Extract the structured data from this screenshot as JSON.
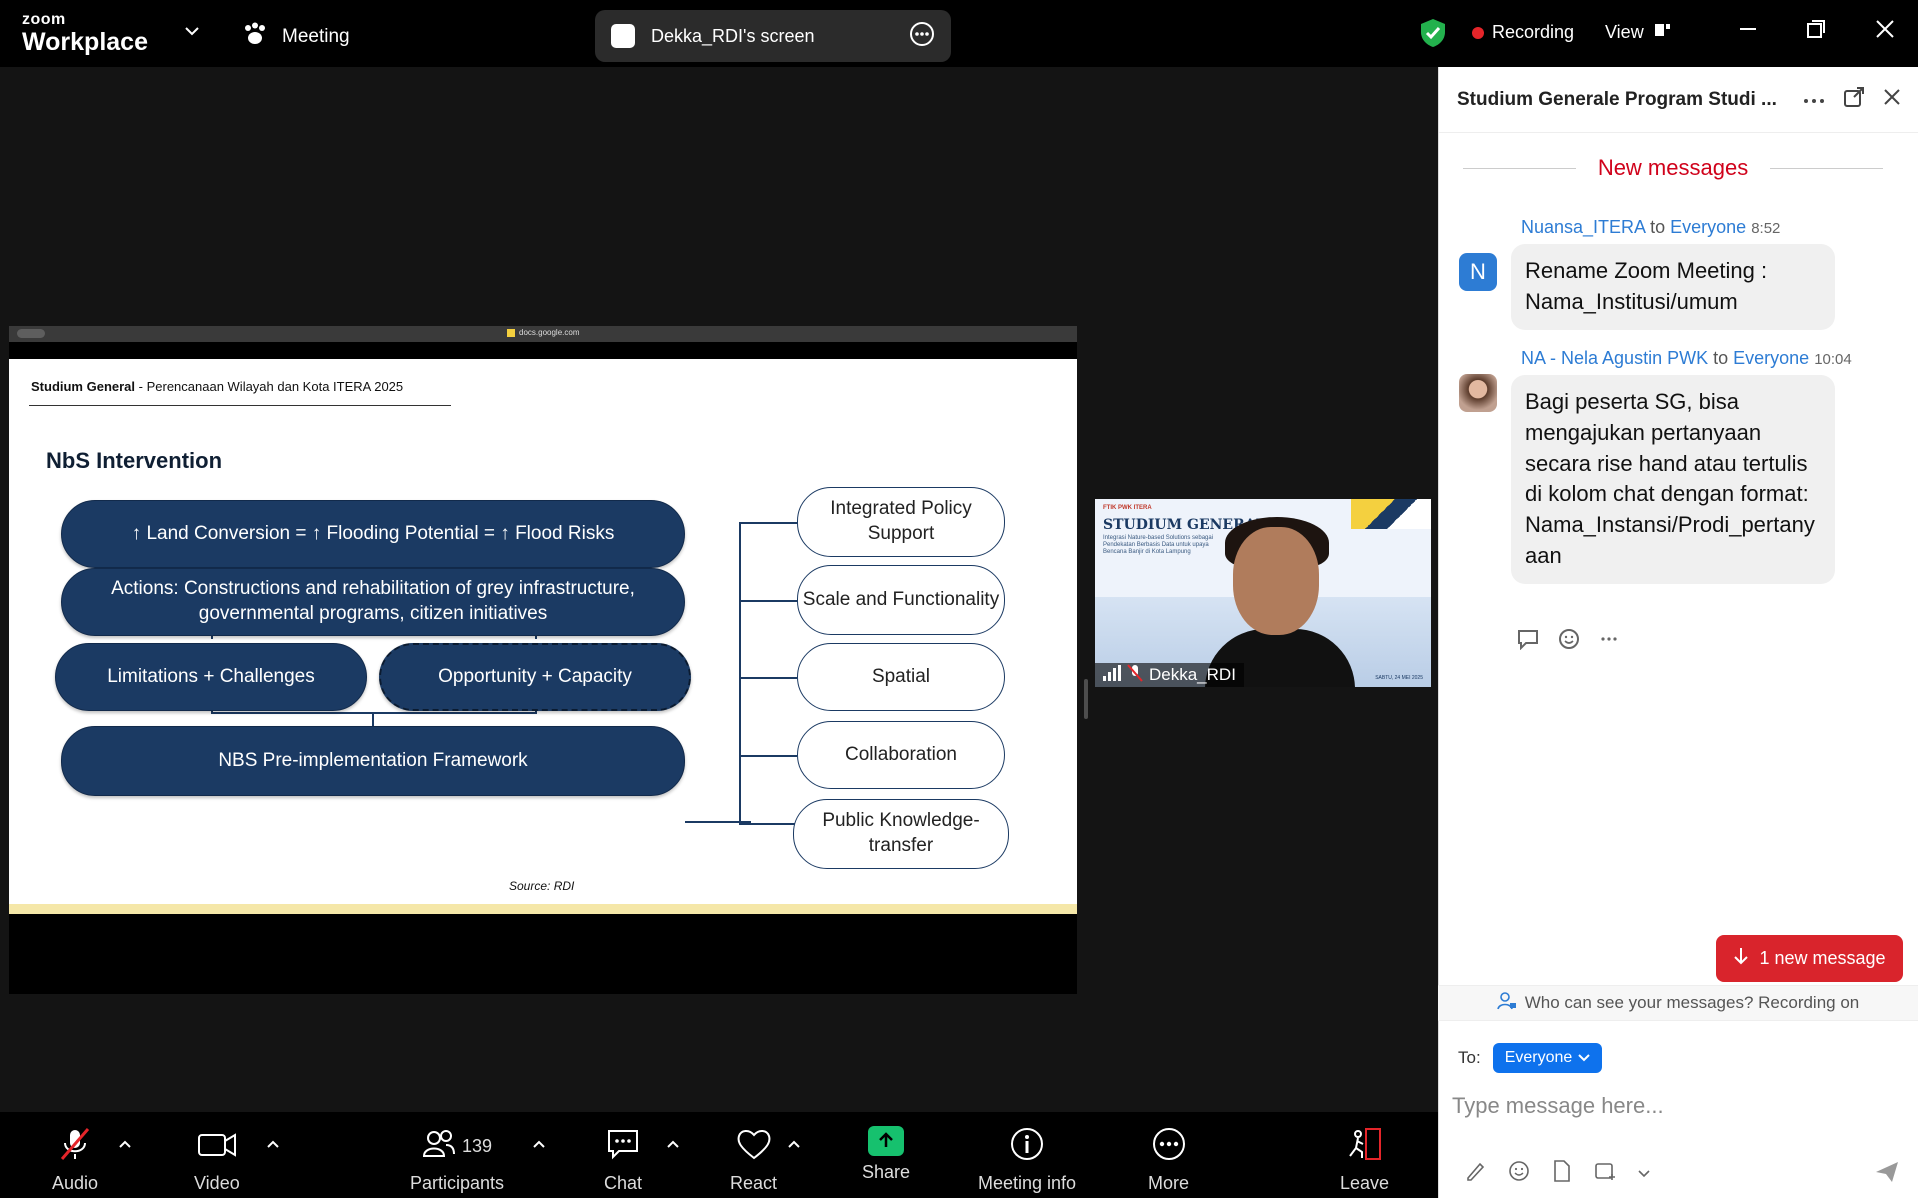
{
  "topbar": {
    "logo_line1": "zoom",
    "logo_line2": "Workplace",
    "meeting_label": "Meeting",
    "screen_share_label": "Dekka_RDI's screen",
    "recording_label": "Recording",
    "view_label": "View"
  },
  "share": {
    "browser_url": "docs.google.com",
    "slide": {
      "header_bold": "Studium General",
      "header_rest": " -  Perencanaan Wilayah dan Kota ITERA 2025",
      "title": "NbS Intervention",
      "box_flood": "↑ Land Conversion = ↑ Flooding Potential = ↑ Flood Risks",
      "box_actions": "Actions: Constructions and rehabilitation of grey infrastructure, governmental programs, citizen initiatives",
      "box_limitations": "Limitations + Challenges",
      "box_opportunity": "Opportunity + Capacity",
      "box_framework": "NBS Pre-implementation Framework",
      "right_items": [
        "Integrated Policy Support",
        "Scale and Functionality",
        "Spatial",
        "Collaboration",
        "Public Knowledge-transfer"
      ],
      "source": "Source: RDI"
    }
  },
  "video": {
    "brand": "FTIK PWK ITERA",
    "poster_title": "STUDIUM GENERALE",
    "poster_sub": "Integrasi Nature-based Solutions sebagai Pendekatan Berbasis Data untuk upaya Bencana Banjir di Kota Lampung",
    "date": "SABTU, 24 MEI 2025",
    "participant_name": "Dekka_RDI"
  },
  "chat": {
    "title": "Studium Generale Program Studi ...",
    "new_messages": "New messages",
    "messages": [
      {
        "avatar": "N",
        "sender": "Nuansa_ITERA",
        "to_word": "to",
        "recipient": "Everyone",
        "time": "8:52",
        "text": "Rename Zoom Meeting :\nNama_Institusi/umum"
      },
      {
        "sender": "NA - Nela Agustin PWK",
        "to_word": "to",
        "recipient": "Everyone",
        "time": "10:04",
        "text": "Bagi peserta SG, bisa mengajukan pertanyaan secara rise hand atau tertulis di kolom chat dengan format: Nama_Instansi/Prodi_pertanyaan"
      }
    ],
    "new_message_button": "1 new message",
    "who_can_see": "Who can see your messages? Recording on",
    "to_label": "To:",
    "to_value": "Everyone",
    "input_placeholder": "Type message here..."
  },
  "toolbar": {
    "audio": "Audio",
    "video": "Video",
    "participants": "Participants",
    "participants_count": "139",
    "chat": "Chat",
    "react": "React",
    "share": "Share",
    "meeting_info": "Meeting info",
    "more": "More",
    "leave": "Leave"
  },
  "colors": {
    "slide_navy": "#1b3a63",
    "recording_red": "#e5252a",
    "share_green": "#16c16e",
    "chat_link_blue": "#2d7cd4",
    "new_messages_red": "#d0021b"
  }
}
